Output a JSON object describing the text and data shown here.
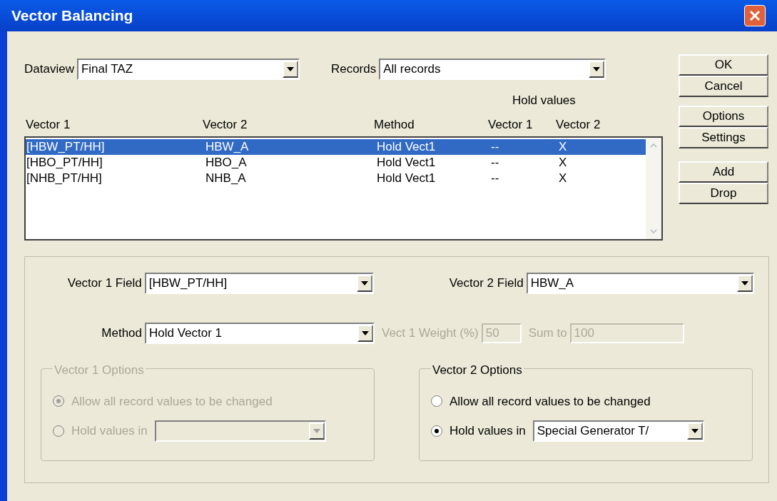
{
  "window": {
    "title": "Vector Balancing"
  },
  "dataview": {
    "label": "Dataview",
    "value": "Final TAZ"
  },
  "records": {
    "label": "Records",
    "value": "All records"
  },
  "buttons_top": [
    "OK",
    "Cancel"
  ],
  "buttons_mid": [
    "Options",
    "Settings"
  ],
  "buttons_low": [
    "Add",
    "Drop"
  ],
  "table": {
    "group_heading": "Hold values",
    "columns": [
      "Vector 1",
      "Vector 2",
      "Method",
      "Vector 1",
      "Vector 2"
    ],
    "rows": [
      {
        "cells": [
          "[HBW_PT/HH]",
          "HBW_A",
          "Hold Vect1",
          "--",
          "X"
        ],
        "selected": true
      },
      {
        "cells": [
          "[HBO_PT/HH]",
          "HBO_A",
          "Hold Vect1",
          "--",
          "X"
        ],
        "selected": false
      },
      {
        "cells": [
          "[NHB_PT/HH]",
          "NHB_A",
          "Hold Vect1",
          "--",
          "X"
        ],
        "selected": false
      }
    ]
  },
  "vector1_field": {
    "label": "Vector 1 Field",
    "value": "[HBW_PT/HH]"
  },
  "vector2_field": {
    "label": "Vector 2 Field",
    "value": "HBW_A"
  },
  "method": {
    "label": "Method",
    "value": "Hold Vector 1"
  },
  "weight": {
    "label": "Vect 1 Weight (%)",
    "value": "50",
    "disabled": true
  },
  "sum_to": {
    "label": "Sum to",
    "value": "100",
    "disabled": true
  },
  "options_groups": [
    {
      "title": "Vector 1 Options",
      "disabled": true,
      "radios": [
        {
          "label": "Allow all record values to be changed",
          "selected": true
        },
        {
          "label": "Hold values in",
          "selected": false
        }
      ]
    },
    {
      "title": "Vector 2 Options",
      "disabled": false,
      "radios": [
        {
          "label": "Allow all record values to be changed",
          "selected": false
        },
        {
          "label": "Hold values in",
          "selected": true
        }
      ],
      "hold_value": "Special Generator T/"
    }
  ]
}
